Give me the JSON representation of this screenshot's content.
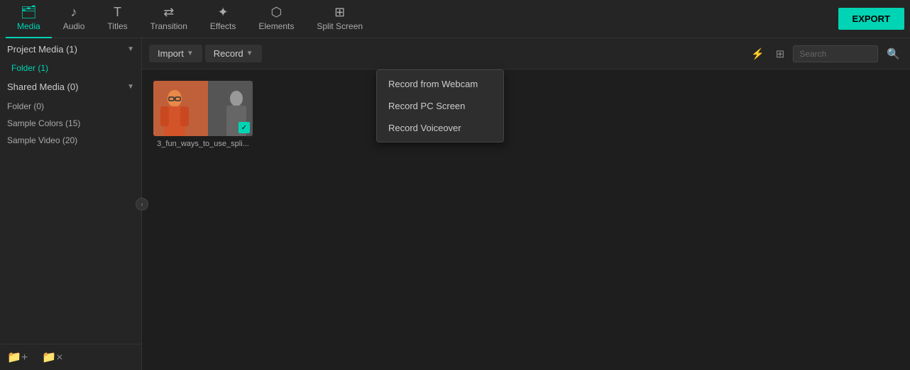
{
  "toolbar": {
    "export_label": "EXPORT",
    "items": [
      {
        "id": "media",
        "label": "Media",
        "icon": "🗂",
        "active": true
      },
      {
        "id": "audio",
        "label": "Audio",
        "icon": "♪"
      },
      {
        "id": "titles",
        "label": "Titles",
        "icon": "T"
      },
      {
        "id": "transition",
        "label": "Transition",
        "icon": "⇄"
      },
      {
        "id": "effects",
        "label": "Effects",
        "icon": "✦"
      },
      {
        "id": "elements",
        "label": "Elements",
        "icon": "⬡"
      },
      {
        "id": "split_screen",
        "label": "Split Screen",
        "icon": "⊞"
      }
    ]
  },
  "sidebar": {
    "project_media": {
      "label": "Project Media (1)",
      "folder": "Folder (1)"
    },
    "shared_media": {
      "label": "Shared Media (0)",
      "folder": "Folder (0)"
    },
    "sample_colors": "Sample Colors (15)",
    "sample_video": "Sample Video (20)",
    "add_folder_label": "Add folder",
    "remove_folder_label": "Remove folder"
  },
  "content_toolbar": {
    "import_label": "Import",
    "record_label": "Record",
    "search_placeholder": "Search"
  },
  "dropdown": {
    "items": [
      "Record from Webcam",
      "Record PC Screen",
      "Record Voiceover"
    ]
  },
  "media_item": {
    "filename": "3_fun_ways_to_use_spli...",
    "checked": true
  }
}
